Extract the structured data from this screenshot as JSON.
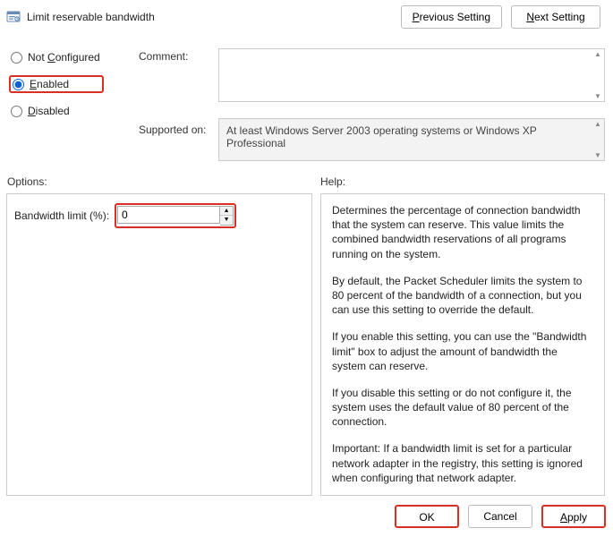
{
  "title": "Limit reservable bandwidth",
  "nav": {
    "prev": "Previous Setting",
    "next": "Next Setting",
    "prev_ul": "P",
    "next_ul": "N"
  },
  "radios": {
    "not_configured": "Not Configured",
    "enabled": "Enabled",
    "disabled": "Disabled",
    "selected": "enabled",
    "nc_ul": "C",
    "en_ul": "E",
    "di_ul": "D"
  },
  "labels": {
    "comment": "Comment:",
    "supported": "Supported on:",
    "options": "Options:",
    "help": "Help:"
  },
  "comment_value": "",
  "supported_value": "At least Windows Server 2003 operating systems or Windows XP Professional",
  "options": {
    "bw_label": "Bandwidth limit (%):",
    "bw_value": "0"
  },
  "help_paragraphs": [
    "Determines the percentage of connection bandwidth that the system can reserve. This value limits the combined bandwidth reservations of all programs running on the system.",
    "By default, the Packet Scheduler limits the system to 80 percent of the bandwidth of a connection, but you can use this setting to override the default.",
    "If you enable this setting, you can use the \"Bandwidth limit\" box to adjust the amount of bandwidth the system can reserve.",
    "If you disable this setting or do not configure it, the system uses the default value of 80 percent of the connection.",
    "Important: If a bandwidth limit is set for a particular network adapter in the registry, this setting is ignored when configuring that network adapter."
  ],
  "buttons": {
    "ok": "OK",
    "cancel": "Cancel",
    "apply": "Apply",
    "apply_ul": "A"
  }
}
